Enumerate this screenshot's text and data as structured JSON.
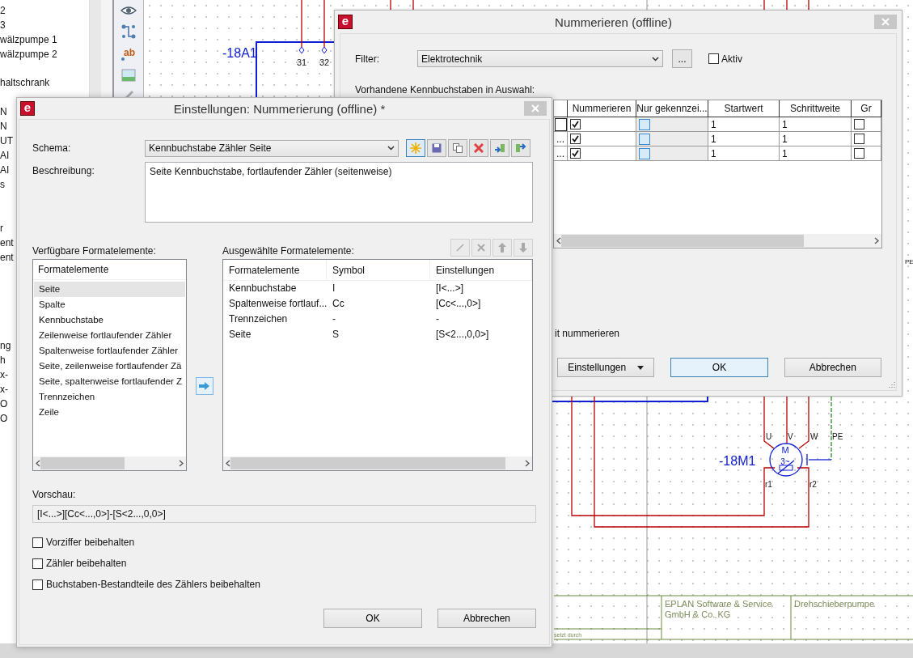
{
  "explorer": {
    "groups": [
      [
        "2",
        "3",
        "wälzpumpe 1",
        "wälzpumpe 2"
      ],
      [
        "haltschrank"
      ],
      [
        "N",
        "N",
        "UT",
        "AI",
        "AI",
        "s"
      ],
      [
        "r",
        "ent",
        "ent"
      ],
      [
        "ng",
        "h",
        "x-",
        "x-",
        "O",
        "O"
      ]
    ]
  },
  "toolbar": [
    {
      "kind": "eye"
    },
    {
      "kind": "connector"
    },
    {
      "kind": "text",
      "glyph": "ab"
    },
    {
      "kind": "image"
    },
    {
      "kind": "pencil"
    }
  ],
  "schematic": {
    "device": {
      "tag": "-18A1",
      "terminals": [
        "31",
        "32"
      ]
    },
    "motor": {
      "tag": "-18M1",
      "symbol": [
        "M",
        "3~"
      ],
      "connections": [
        "U",
        "V",
        "W",
        "PE"
      ],
      "thermistor": [
        "r1",
        "r2"
      ]
    },
    "edge_label": "PE",
    "title_block": {
      "company": [
        "EPLAN Software & Service",
        "GmbH & Co. KG"
      ],
      "title": "Drehschieberpumpe",
      "note": "setzt durch"
    }
  },
  "numbering_dialog": {
    "logo": "e",
    "title": "Nummerieren (offline)",
    "filter": {
      "label": "Filter:",
      "value": "Elektrotechnik",
      "browse": "...",
      "active": {
        "label": "Aktiv",
        "checked": false
      }
    },
    "list_label": "Vorhandene Kennbuchstaben in Auswahl:",
    "table": {
      "columns": [
        {
          "kind": "text"
        },
        {
          "kind": "checkbox",
          "header": "Nummerieren"
        },
        {
          "kind": "option",
          "header": "Nur gekennzei..."
        },
        {
          "kind": "text",
          "header": "Startwert"
        },
        {
          "kind": "text",
          "header": "Schrittweite"
        },
        {
          "kind": "checkbox",
          "header": "Gr"
        }
      ],
      "rows": [
        [
          {
            "focused": true
          },
          {
            "checked": true
          },
          {
            "checked": false
          },
          {
            "text": "1"
          },
          {
            "text": "1"
          },
          {
            "checked": false
          }
        ],
        [
          {
            "text": "...",
            "focused": false
          },
          {
            "checked": true
          },
          {
            "checked": false
          },
          {
            "text": "1"
          },
          {
            "text": "1"
          },
          {
            "checked": false
          }
        ],
        [
          {
            "text": "...",
            "focused": false
          },
          {
            "checked": true
          },
          {
            "checked": false
          },
          {
            "text": "1"
          },
          {
            "text": "1"
          },
          {
            "checked": false
          }
        ]
      ]
    },
    "option_fragment": "it nummerieren",
    "buttons": [
      {
        "label": "Einstellungen",
        "kind": "menu"
      },
      {
        "label": "OK",
        "kind": "default"
      },
      {
        "label": "Abbrechen",
        "kind": "plain"
      }
    ]
  },
  "settings_dialog": {
    "logo": "e",
    "title": "Einstellungen: Nummerierung (offline) *",
    "schema": {
      "label": "Schema:",
      "value": "Kennbuchstabe Zähler Seite"
    },
    "schema_tools": [
      {
        "kind": "new",
        "selected": true
      },
      {
        "kind": "save",
        "selected": false
      },
      {
        "kind": "copy",
        "selected": false
      },
      {
        "kind": "delete",
        "selected": false
      },
      {
        "kind": "import",
        "selected": false
      },
      {
        "kind": "export",
        "selected": false
      }
    ],
    "description": {
      "label": "Beschreibung:",
      "value": "Seite Kennbuchstabe, fortlaufender Zähler (seitenweise)"
    },
    "available": {
      "label": "Verfügbare Formatelemente:",
      "header": "Formatelemente",
      "items": [
        {
          "text": "Seite",
          "selected": true
        },
        {
          "text": "Spalte",
          "selected": false
        },
        {
          "text": "Kennbuchstabe",
          "selected": false
        },
        {
          "text": "Zeilenweise fortlaufender Zähler",
          "selected": false
        },
        {
          "text": "Spaltenweise fortlaufender Zähler",
          "selected": false
        },
        {
          "text": "Seite, zeilenweise fortlaufender Zä",
          "selected": false
        },
        {
          "text": "Seite, spaltenweise fortlaufender Z",
          "selected": false
        },
        {
          "text": "Trennzeichen",
          "selected": false
        },
        {
          "text": "Zeile",
          "selected": false
        }
      ]
    },
    "chosen": {
      "label": "Ausgewählte Formatelemente:",
      "tools": [
        {
          "kind": "edit",
          "disabled": true
        },
        {
          "kind": "remove",
          "disabled": true
        },
        {
          "kind": "up",
          "disabled": true
        },
        {
          "kind": "down",
          "disabled": true
        }
      ],
      "columns": [
        "Formatelemente",
        "Symbol",
        "Einstellungen"
      ],
      "rows": [
        [
          "Kennbuchstabe",
          "I",
          "[I<...>]"
        ],
        [
          "Spaltenweise fortlauf...",
          "Cc",
          "[Cc<...,0>]"
        ],
        [
          "Trennzeichen",
          "-",
          "-"
        ],
        [
          "Seite",
          "S",
          "[S<2...,0,0>]"
        ]
      ]
    },
    "preview": {
      "label": "Vorschau:",
      "value": "[I<...>][Cc<...,0>]-[S<2...,0,0>]"
    },
    "options": [
      {
        "label": "Vorziffer beibehalten",
        "checked": false
      },
      {
        "label": "Zähler beibehalten",
        "checked": false
      },
      {
        "label": "Buchstaben-Bestandteile des Zählers beibehalten",
        "checked": false
      }
    ],
    "buttons": [
      {
        "label": "OK"
      },
      {
        "label": "Abbrechen"
      }
    ]
  }
}
